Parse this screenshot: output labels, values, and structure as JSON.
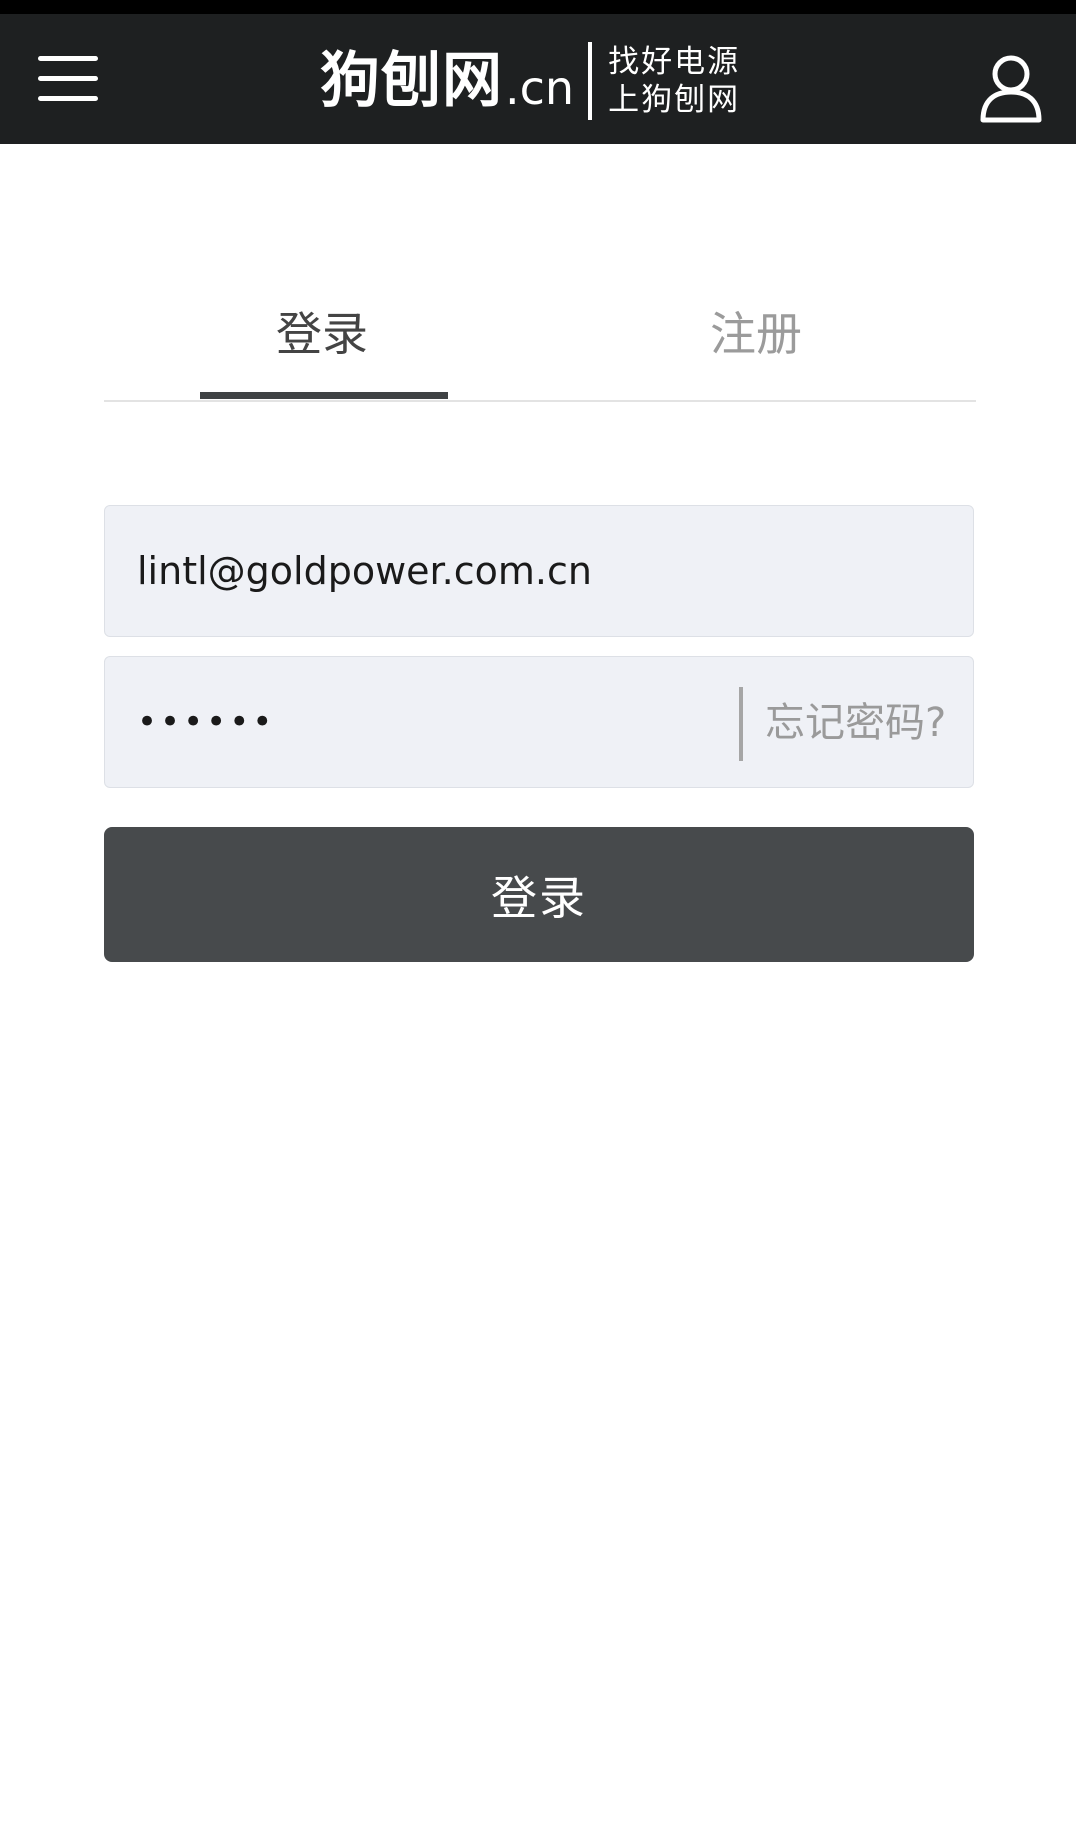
{
  "header": {
    "logo_main": "狗刨网",
    "logo_domain": ".cn",
    "slogan_line1": "找好电源",
    "slogan_line2": "上狗刨网",
    "menu_icon": "hamburger-menu-icon",
    "user_icon": "user-icon"
  },
  "tabs": [
    {
      "label": "登录",
      "active": true
    },
    {
      "label": "注册",
      "active": false
    }
  ],
  "form": {
    "email_value": "lintl@goldpower.com.cn",
    "password_value": "••••••",
    "forgot_label": "忘记密码?",
    "submit_label": "登录"
  },
  "colors": {
    "header_bg": "#1e2021",
    "active_tab_indicator": "#3f4244",
    "button_bg": "#474a4c",
    "input_bg": "#eff1f6"
  }
}
